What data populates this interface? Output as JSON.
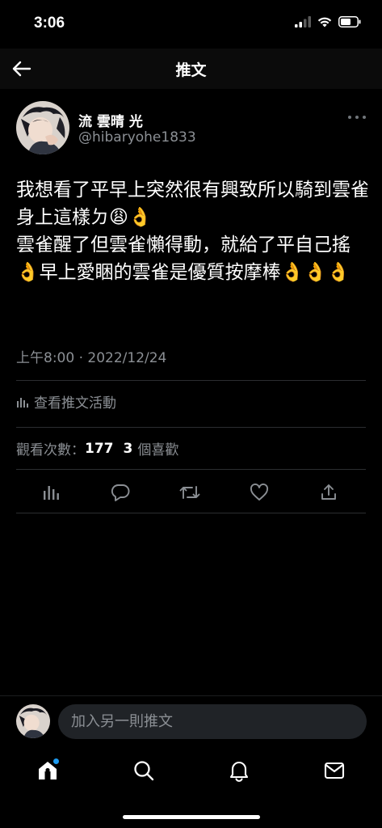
{
  "status_bar": {
    "time": "3:06"
  },
  "header": {
    "title": "推文"
  },
  "tweet": {
    "display_name": "流 雲晴 光",
    "handle": "@hibaryohe1833",
    "text": "我想看了平早上突然很有興致所以騎到雲雀身上這樣ㄉ😩👌\n雲雀醒了但雲雀懶得動，就給了平自己搖👌早上愛睏的雲雀是優質按摩棒👌👌👌",
    "timestamp": "上午8:00 · 2022/12/24",
    "activity_label": "查看推文活動",
    "views_label": "觀看次數：",
    "views_count": "177",
    "likes_count": "3",
    "likes_label": "個喜歡"
  },
  "reply": {
    "placeholder": "加入另一則推文"
  },
  "colors": {
    "accent": "#1d9bf0",
    "background": "#000000",
    "muted": "#8b8f94"
  },
  "icons": {
    "actions": [
      "analytics-icon",
      "reply-icon",
      "retweet-icon",
      "like-icon",
      "share-icon"
    ],
    "nav": [
      "home-icon",
      "search-icon",
      "notifications-icon",
      "messages-icon"
    ]
  }
}
